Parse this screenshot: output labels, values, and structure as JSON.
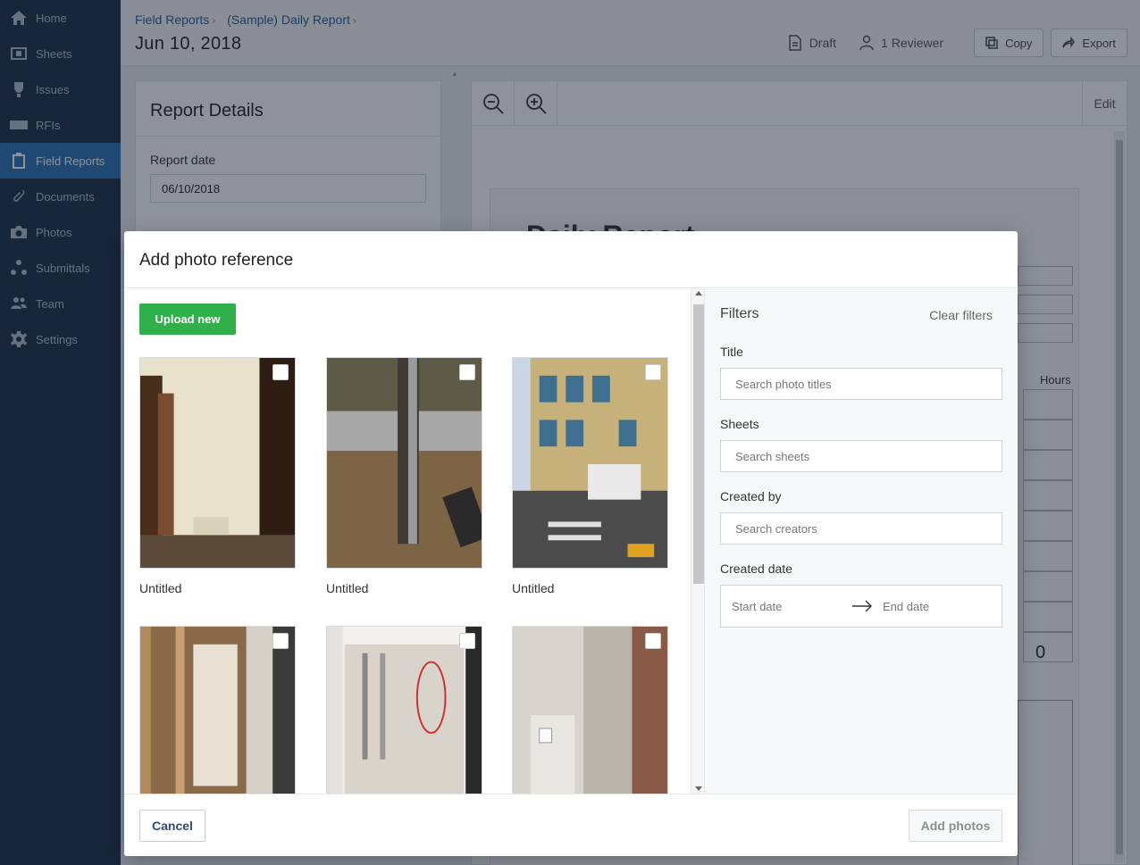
{
  "sidebar": {
    "items": [
      {
        "label": "Home",
        "icon": "home-icon"
      },
      {
        "label": "Sheets",
        "icon": "sheets-icon"
      },
      {
        "label": "Issues",
        "icon": "issues-icon"
      },
      {
        "label": "RFIs",
        "icon": "rfis-icon"
      },
      {
        "label": "Field Reports",
        "icon": "clipboard-icon",
        "active": true
      },
      {
        "label": "Documents",
        "icon": "paperclip-icon"
      },
      {
        "label": "Photos",
        "icon": "camera-icon"
      },
      {
        "label": "Submittals",
        "icon": "submittals-icon"
      },
      {
        "label": "Team",
        "icon": "team-icon"
      },
      {
        "label": "Settings",
        "icon": "gear-icon"
      }
    ],
    "active_color": "#2b6fb0",
    "bg_color": "#1d2f44"
  },
  "header": {
    "breadcrumb": [
      "Field Reports",
      "(Sample) Daily Report"
    ],
    "date": "Jun 10, 2018",
    "status": "Draft",
    "reviewers": "1 Reviewer",
    "copy_label": "Copy",
    "export_label": "Export"
  },
  "details": {
    "title": "Report Details",
    "date_label": "Report date",
    "date_value": "06/10/2018"
  },
  "viewer": {
    "edit_label": "Edit",
    "hours_label": "Hours",
    "total": "0",
    "doc_title": "Daily Report"
  },
  "modal": {
    "title": "Add photo reference",
    "upload_label": "Upload new",
    "photos": [
      {
        "name": "Untitled"
      },
      {
        "name": "Untitled"
      },
      {
        "name": "Untitled"
      },
      {
        "name": ""
      },
      {
        "name": ""
      },
      {
        "name": ""
      }
    ],
    "filters": {
      "title": "Filters",
      "clear_label": "Clear filters",
      "title_label": "Title",
      "title_placeholder": "Search photo titles",
      "sheets_label": "Sheets",
      "sheets_placeholder": "Search sheets",
      "created_by_label": "Created by",
      "created_by_placeholder": "Search creators",
      "created_date_label": "Created date",
      "start_placeholder": "Start date",
      "end_placeholder": "End date"
    },
    "cancel_label": "Cancel",
    "add_label": "Add photos",
    "upload_color": "#2fb04a"
  }
}
